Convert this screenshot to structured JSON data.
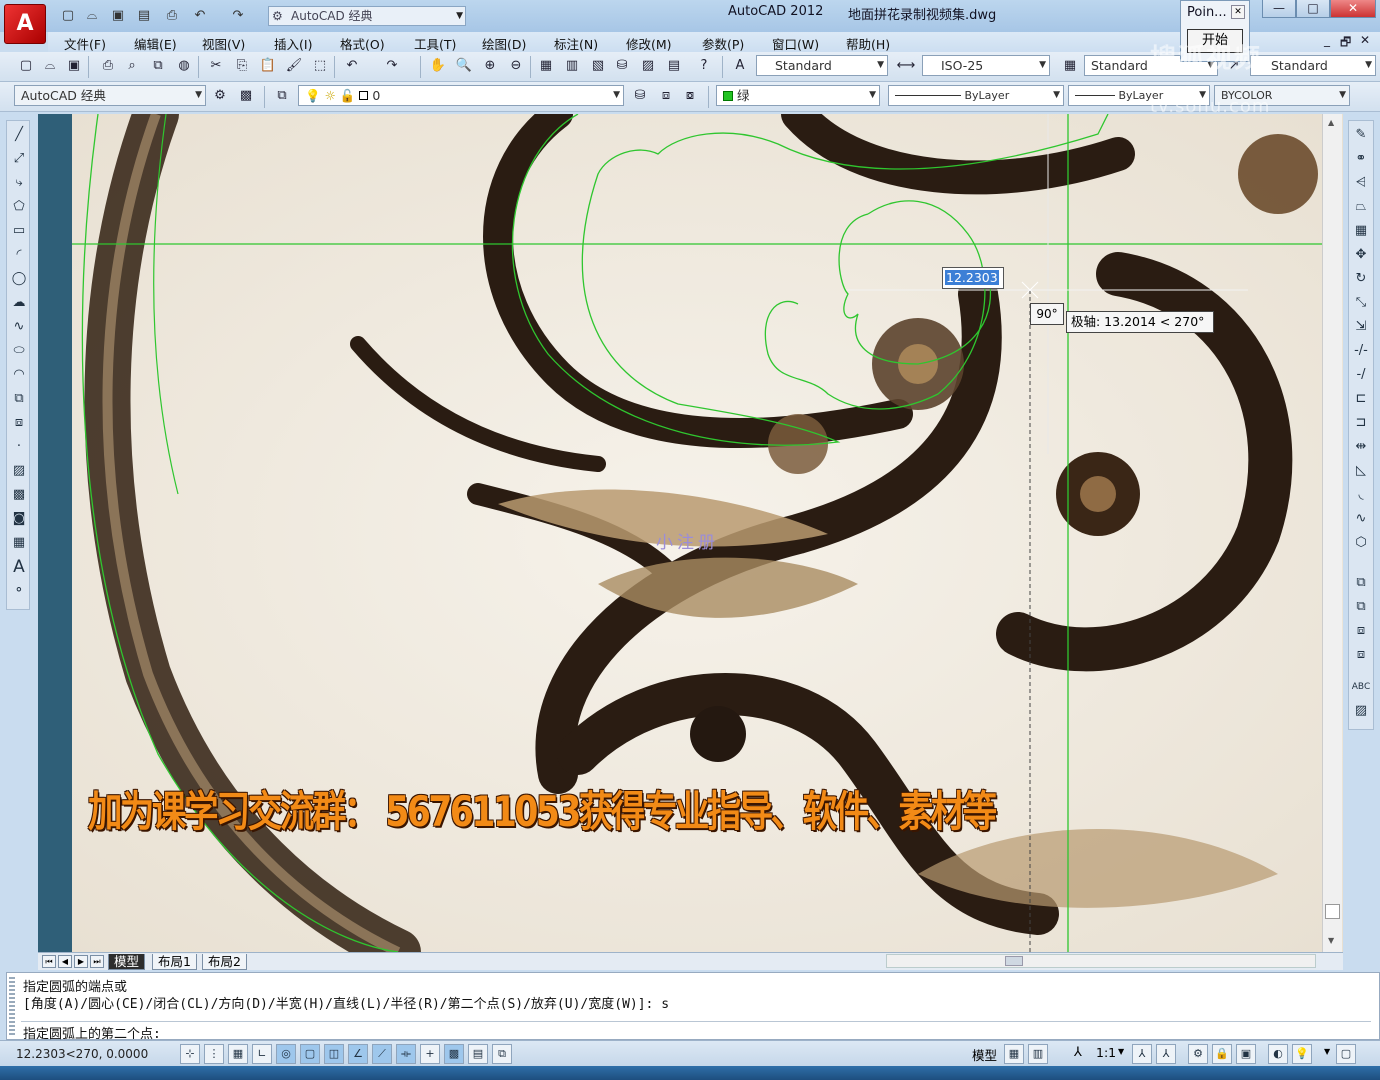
{
  "window": {
    "app_title": "AutoCAD 2012",
    "file_name": "地面拼花录制视频集.dwg",
    "logo_letter": "A",
    "minimize": "—",
    "maximize": "□",
    "close": "✕"
  },
  "workspace_combo": "AutoCAD 经典",
  "popup": {
    "title": "Poin...",
    "close": "✕",
    "button": "开始"
  },
  "menus": [
    "文件(F)",
    "编辑(E)",
    "视图(V)",
    "插入(I)",
    "格式(O)",
    "工具(T)",
    "绘图(D)",
    "标注(N)",
    "修改(M)",
    "参数(P)",
    "窗口(W)",
    "帮助(H)"
  ],
  "doc_controls": [
    "_",
    "🗗",
    "✕"
  ],
  "toolbar1": {
    "text_style": "Standard",
    "dim_style": "ISO-25",
    "table_style": "Standard",
    "mleader_style": "Standard"
  },
  "toolbar2": {
    "workspace": "AutoCAD 经典",
    "layer": "0",
    "color": "绿",
    "linetype": "ByLayer",
    "lineweight": "ByLayer",
    "plotstyle": "BYCOLOR"
  },
  "canvas": {
    "dynamic_input_value": "12.2303",
    "angle_tooltip": "90°",
    "polar_tooltip": "极轴: 13.2014 < 270°",
    "overlay_label": "小注册",
    "promo_text": "加为课学习交流群： 567611053获得专业指导、软件、素材等"
  },
  "tabs": [
    "模型",
    "布局1",
    "布局2"
  ],
  "command": {
    "line1": "指定圆弧的端点或",
    "line2": "[角度(A)/圆心(CE)/闭合(CL)/方向(D)/半宽(H)/直线(L)/半径(R)/第二个点(S)/放弃(U)/宽度(W)]: s",
    "prompt": "指定圆弧上的第二个点:"
  },
  "status": {
    "coords": "12.2303<270, 0.0000",
    "model": "模型",
    "scale": "1:1"
  },
  "watermark": {
    "line1": "搜狐视频",
    "line2": "tv.sohu.com"
  },
  "colors": {
    "drawing_lines": "#34c534",
    "accent_selection": "#3c7fd6",
    "promo": "#f28a16",
    "close_button": "#c33"
  }
}
